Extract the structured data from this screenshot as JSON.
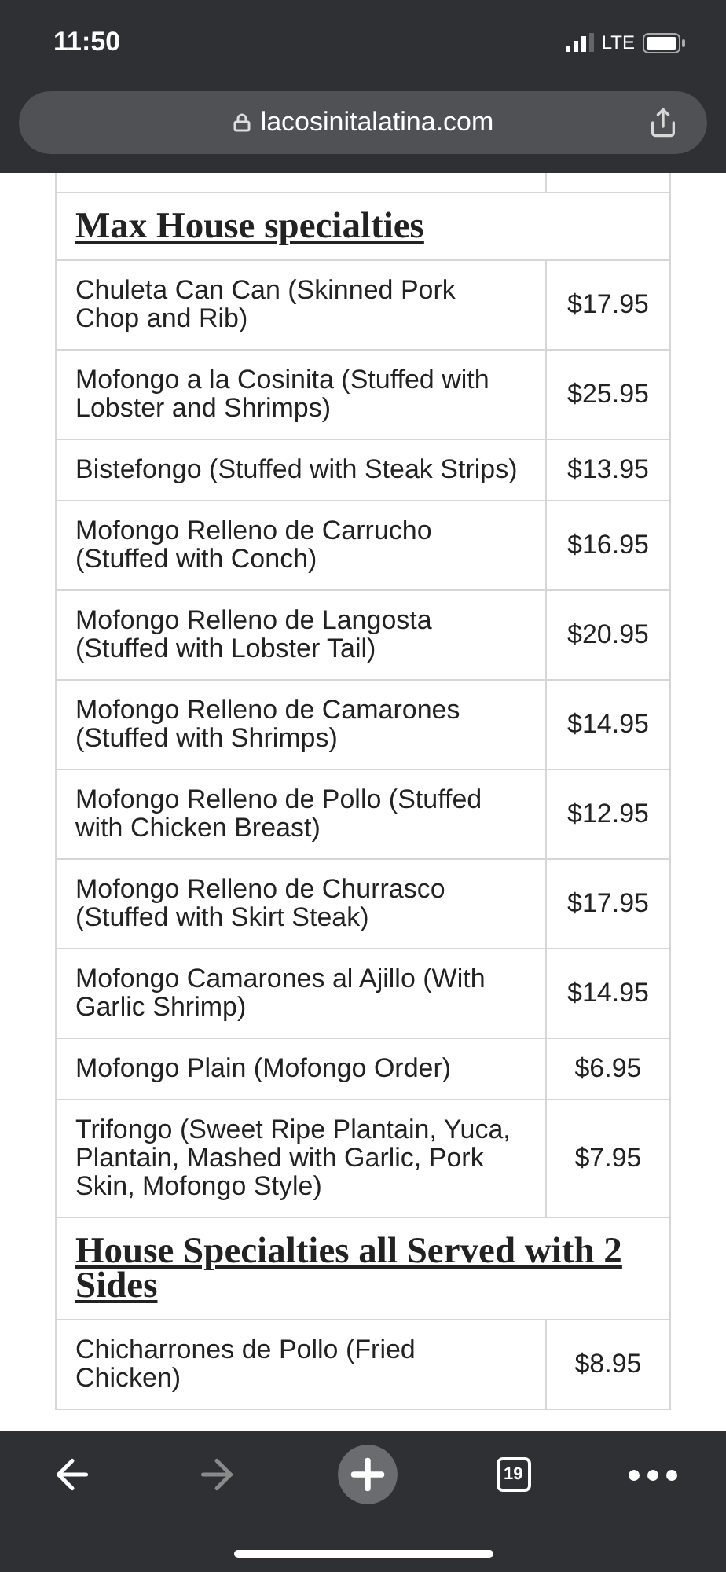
{
  "status_bar": {
    "time": "11:50",
    "network": "LTE"
  },
  "address_bar": {
    "url": "lacosinitalatina.com"
  },
  "menu": [
    {
      "title": "Max House specialties",
      "items": [
        {
          "name": "Chuleta Can Can (Skinned Pork Chop and Rib)",
          "price": "$17.95"
        },
        {
          "name": "Mofongo a la Cosinita (Stuffed with Lobster and Shrimps)",
          "price": "$25.95"
        },
        {
          "name": "Bistefongo (Stuffed with Steak Strips)",
          "price": "$13.95"
        },
        {
          "name": "Mofongo Relleno de Carrucho (Stuffed with Conch)",
          "price": "$16.95"
        },
        {
          "name": "Mofongo Relleno de Langosta (Stuffed with Lobster Tail)",
          "price": "$20.95"
        },
        {
          "name": "Mofongo Relleno de Camarones (Stuffed with Shrimps)",
          "price": "$14.95"
        },
        {
          "name": "Mofongo Relleno de Pollo (Stuffed with Chicken Breast)",
          "price": "$12.95"
        },
        {
          "name": "Mofongo Relleno de Churrasco (Stuffed with Skirt Steak)",
          "price": "$17.95"
        },
        {
          "name": "Mofongo Camarones al Ajillo (With Garlic Shrimp)",
          "price": "$14.95"
        },
        {
          "name": "Mofongo Plain (Mofongo Order)",
          "price": "$6.95"
        },
        {
          "name": "Trifongo (Sweet Ripe Plantain, Yuca, Plantain, Mashed with Garlic, Pork Skin, Mofongo Style)",
          "price": "$7.95"
        }
      ]
    },
    {
      "title": "House Specialties all Served with 2 Sides",
      "items": [
        {
          "name": "Chicharrones de Pollo (Fried Chicken)",
          "price": "$8.95"
        }
      ]
    }
  ],
  "toolbar": {
    "back_enabled": true,
    "forward_enabled": false,
    "tab_count": "19"
  }
}
